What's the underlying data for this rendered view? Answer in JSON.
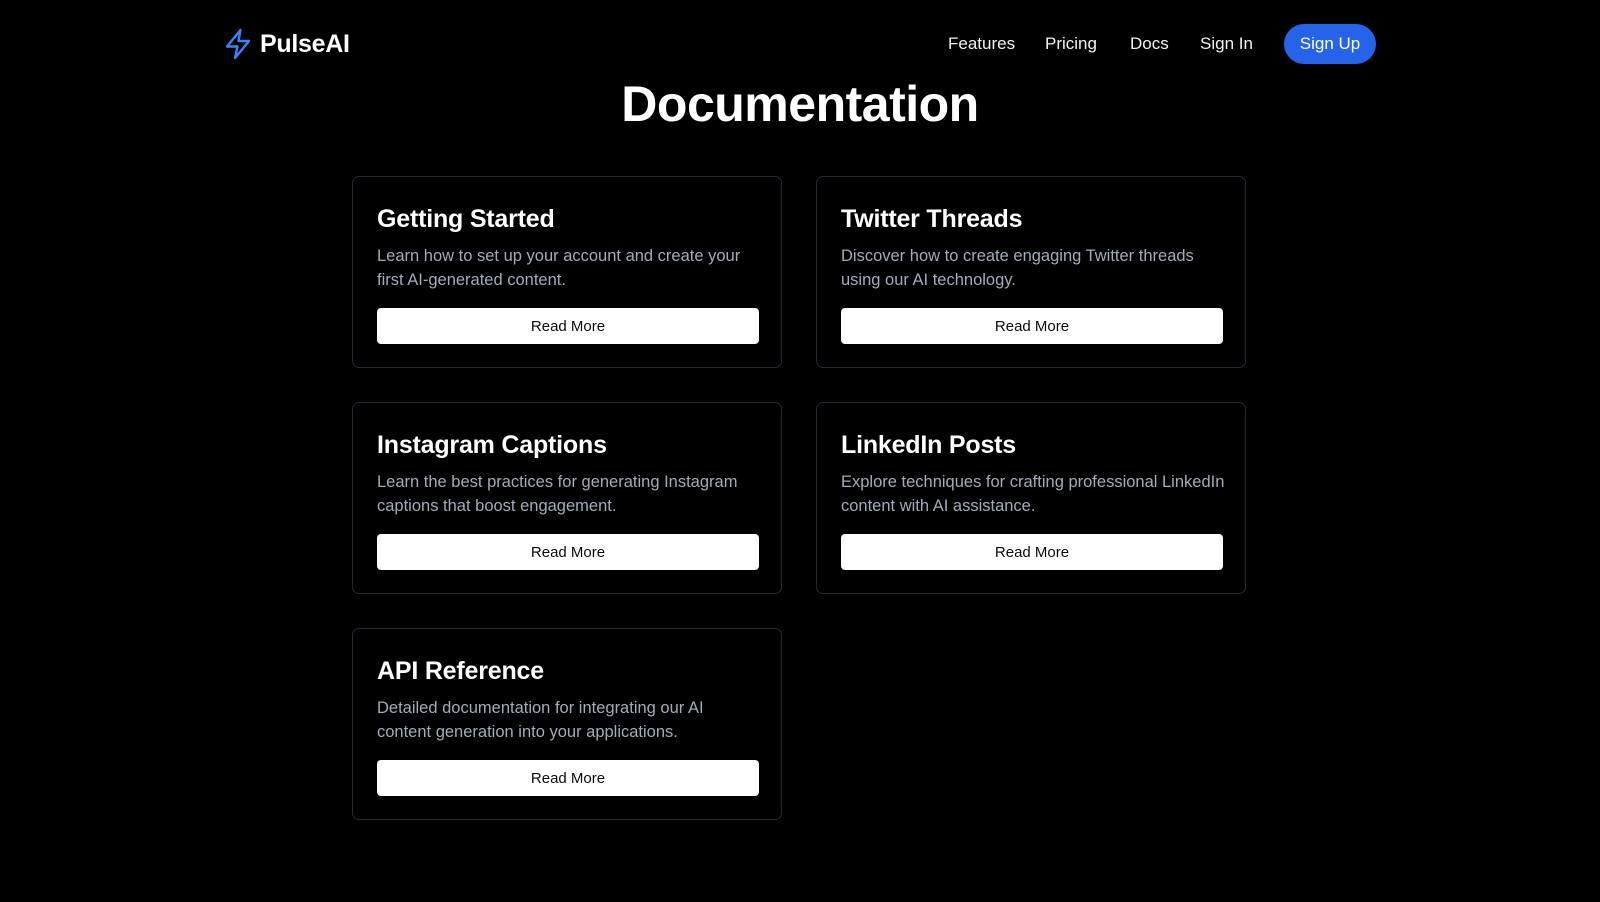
{
  "header": {
    "brand": "PulseAI",
    "logo_icon": "lightning-bolt-icon",
    "accent_color": "#2563eb",
    "nav": {
      "features": "Features",
      "pricing": "Pricing",
      "docs": "Docs",
      "signin": "Sign In"
    },
    "signup_label": "Sign Up"
  },
  "page": {
    "title": "Documentation"
  },
  "cards": [
    {
      "title": "Getting Started",
      "description": "Learn how to set up your account and create your first AI-generated content.",
      "button": "Read More"
    },
    {
      "title": "Twitter Threads",
      "description": "Discover how to create engaging Twitter threads using our AI technology.",
      "button": "Read More"
    },
    {
      "title": "Instagram Captions",
      "description": "Learn the best practices for generating Instagram captions that boost engagement.",
      "button": "Read More"
    },
    {
      "title": "LinkedIn Posts",
      "description": "Explore techniques for crafting professional LinkedIn content with AI assistance.",
      "button": "Read More"
    },
    {
      "title": "API Reference",
      "description": "Detailed documentation for integrating our AI content generation into your applications.",
      "button": "Read More"
    }
  ]
}
